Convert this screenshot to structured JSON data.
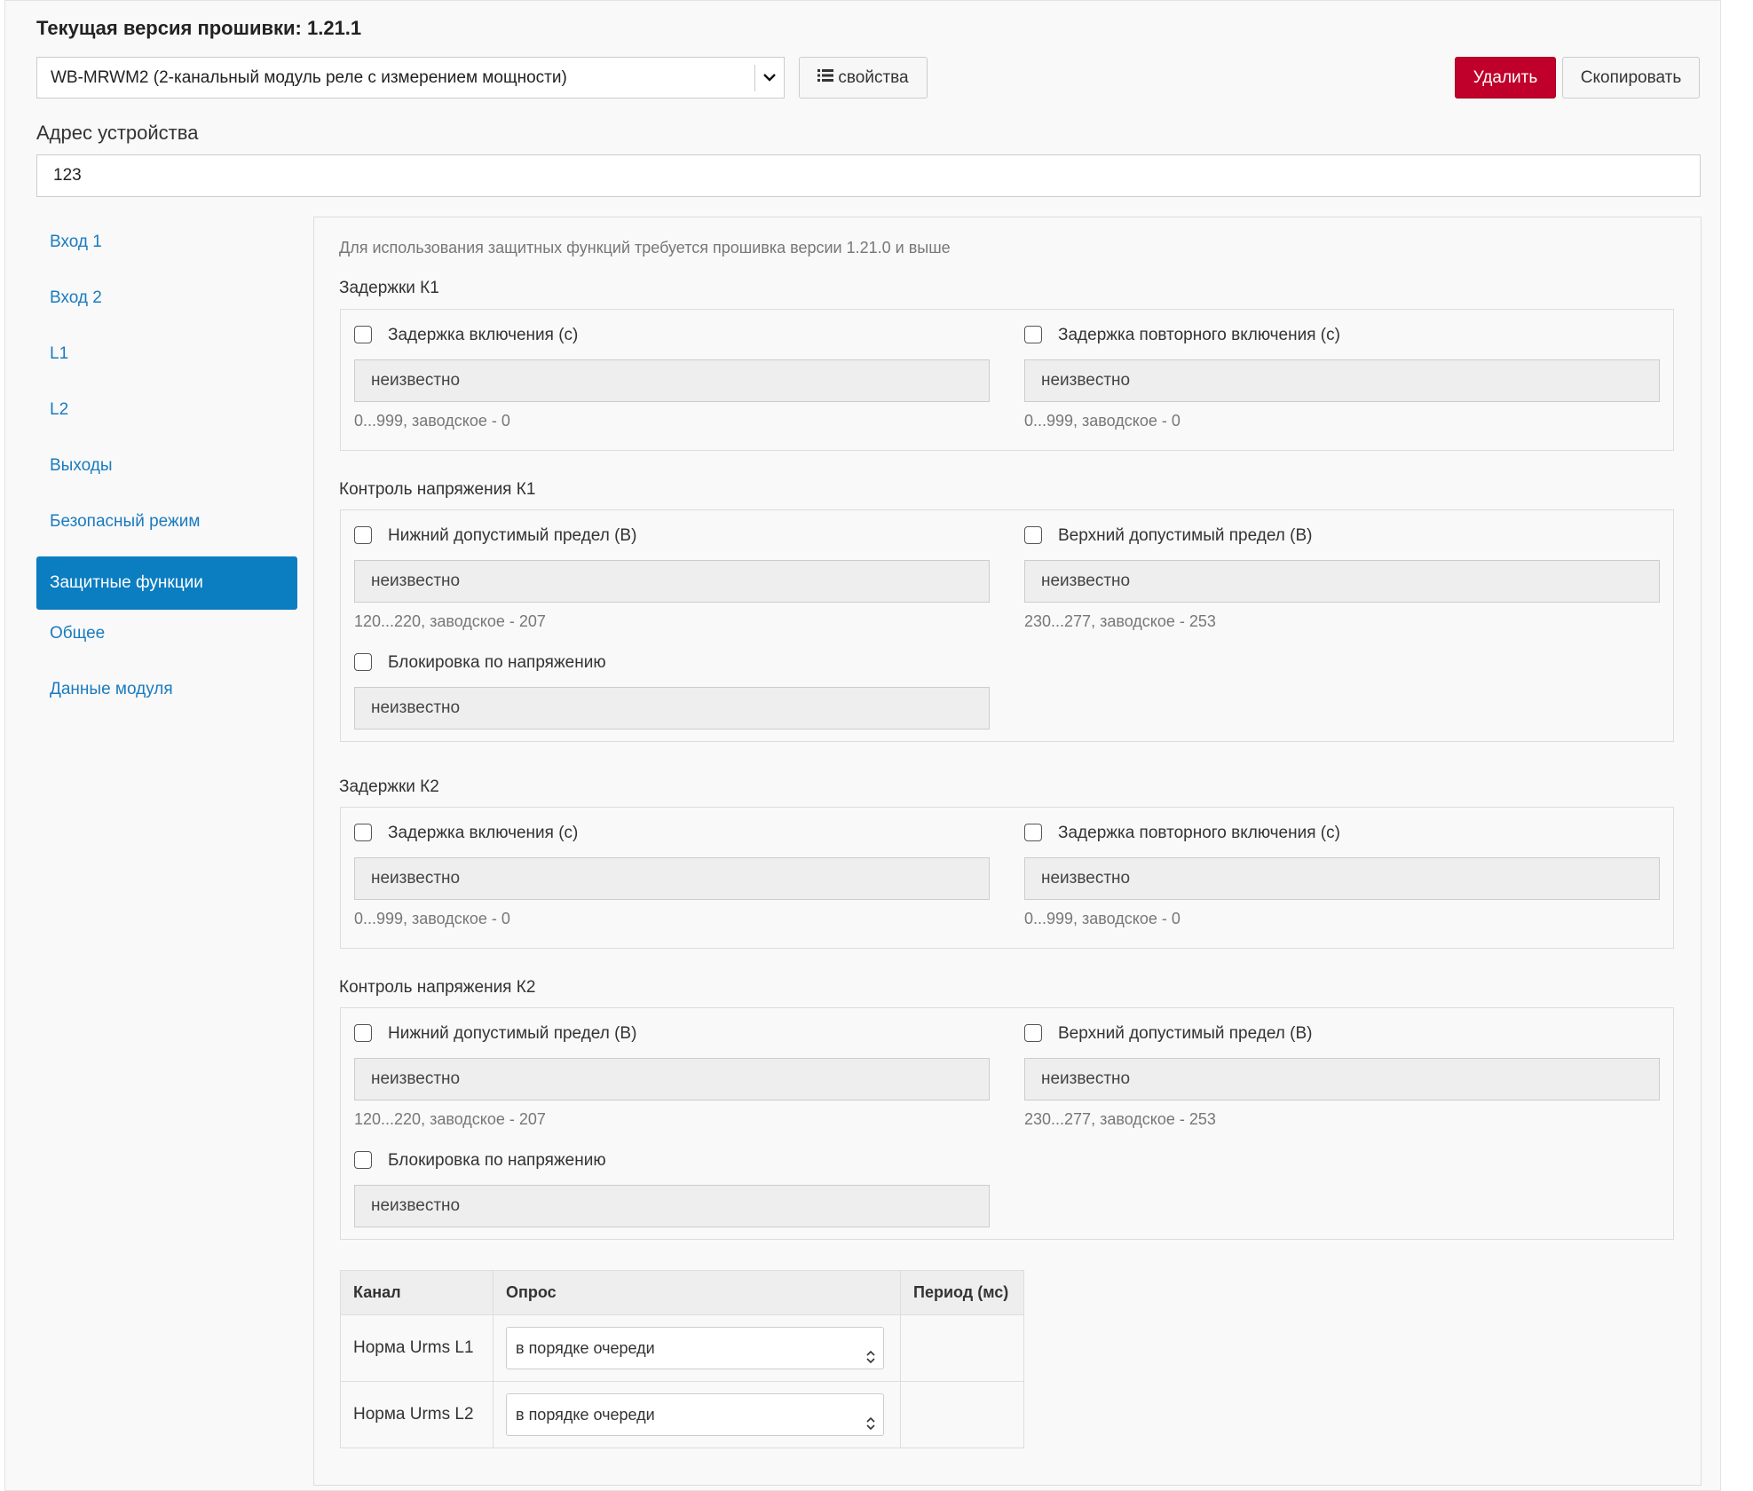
{
  "header": {
    "firmware_title": "Текущая версия прошивки: 1.21.1",
    "device_select_value": "WB-MRWM2 (2-канальный модуль реле с измерением мощности)",
    "properties_button": "свойства",
    "delete_button": "Удалить",
    "copy_button": "Скопировать"
  },
  "address": {
    "label": "Адрес устройства",
    "value": "123"
  },
  "sidebar": {
    "items": [
      {
        "label": "Вход 1"
      },
      {
        "label": "Вход 2"
      },
      {
        "label": "L1"
      },
      {
        "label": "L2"
      },
      {
        "label": "Выходы"
      },
      {
        "label": "Безопасный режим"
      },
      {
        "label": "Защитные функции",
        "active": true
      },
      {
        "label": "Общее"
      },
      {
        "label": "Данные модуля"
      }
    ]
  },
  "content": {
    "note": "Для использования защитных функций требуется прошивка версии 1.21.0 и выше",
    "groups": [
      {
        "title": "Задержки К1",
        "fields": [
          {
            "label": "Задержка включения (с)",
            "value": "неизвестно",
            "hint": "0...999, заводское - 0"
          },
          {
            "label": "Задержка повторного включения (с)",
            "value": "неизвестно",
            "hint": "0...999, заводское - 0"
          }
        ]
      },
      {
        "title": "Контроль напряжения К1",
        "fields": [
          {
            "label": "Нижний допустимый предел (В)",
            "value": "неизвестно",
            "hint": "120...220, заводское - 207"
          },
          {
            "label": "Верхний допустимый предел (В)",
            "value": "неизвестно",
            "hint": "230...277, заводское - 253"
          },
          {
            "label": "Блокировка по напряжению",
            "value": "неизвестно"
          }
        ]
      },
      {
        "title": "Задержки К2",
        "fields": [
          {
            "label": "Задержка включения (с)",
            "value": "неизвестно",
            "hint": "0...999, заводское - 0"
          },
          {
            "label": "Задержка повторного включения (с)",
            "value": "неизвестно",
            "hint": "0...999, заводское - 0"
          }
        ]
      },
      {
        "title": "Контроль напряжения К2",
        "fields": [
          {
            "label": "Нижний допустимый предел (В)",
            "value": "неизвестно",
            "hint": "120...220, заводское - 207"
          },
          {
            "label": "Верхний допустимый предел (В)",
            "value": "неизвестно",
            "hint": "230...277, заводское - 253"
          },
          {
            "label": "Блокировка по напряжению",
            "value": "неизвестно"
          }
        ]
      }
    ],
    "channels_table": {
      "headers": [
        "Канал",
        "Опрос",
        "Период (мс)"
      ],
      "rows": [
        {
          "channel": "Норма Urms L1",
          "poll": "в порядке очереди",
          "period": ""
        },
        {
          "channel": "Норма Urms L2",
          "poll": "в порядке очереди",
          "period": ""
        }
      ]
    }
  },
  "colors": {
    "accent": "#0b7dc1",
    "danger": "#c0002a",
    "link": "#1a7bbf"
  }
}
